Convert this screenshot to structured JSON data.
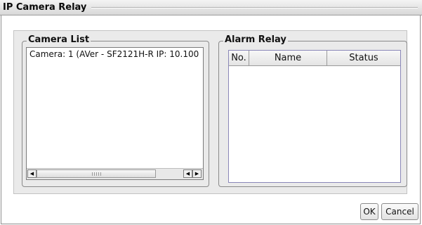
{
  "window": {
    "title": "IP Camera Relay"
  },
  "camera_list": {
    "legend": "Camera List",
    "items": [
      "Camera: 1 (AVer - SF2121H-R IP: 10.100"
    ]
  },
  "alarm_relay": {
    "legend": "Alarm Relay",
    "columns": [
      "No.",
      "Name",
      "Status"
    ],
    "rows": []
  },
  "buttons": {
    "ok": "OK",
    "cancel": "Cancel"
  }
}
